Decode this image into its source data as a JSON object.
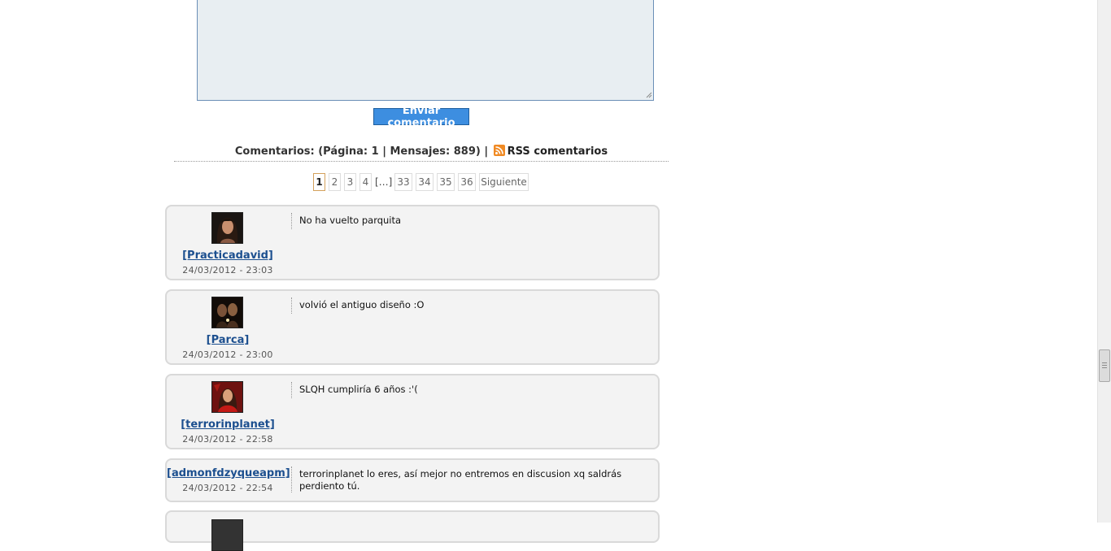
{
  "form": {
    "textarea_value": "",
    "submit_label": "Enviar comentario"
  },
  "comments_header": {
    "label": "Comentarios: (Página: ",
    "page": "1",
    "messages_label": " | Mensajes: ",
    "messages": "889",
    "close": ") |",
    "rss_label": "RSS comentarios",
    "rss_icon": "rss-icon",
    "rss_color": "#f08a24"
  },
  "pagination": {
    "pages": [
      "1",
      "2",
      "3",
      "4",
      "[…]",
      "33",
      "34",
      "35",
      "36",
      "Siguiente"
    ],
    "current": "1"
  },
  "comments": [
    {
      "author": "[Practicadavid]",
      "date": "24/03/2012 - 23:03",
      "text": "No ha vuelto parquita",
      "avatar": "avatar-woman-dark-hair"
    },
    {
      "author": "[Parca]",
      "date": "24/03/2012 - 23:00",
      "text": "volvió el antiguo diseño :O",
      "avatar": "avatar-two-people"
    },
    {
      "author": "[terrorinplanet]",
      "date": "24/03/2012 - 22:58",
      "text": "SLQH cumpliría 6 años :'(",
      "avatar": "avatar-woman-red-dress"
    },
    {
      "author": "[admonfdzyqueapm]",
      "date": "24/03/2012 - 22:54",
      "text": "terrorinplanet lo eres, así mejor no entremos en discusion xq saldrás perdiento tú."
    }
  ],
  "colors": {
    "link": "#1c4f8f",
    "button": "#3d8ee0",
    "comment_bg": "#f3f3f3",
    "current_page_border": "#d4a15c"
  }
}
